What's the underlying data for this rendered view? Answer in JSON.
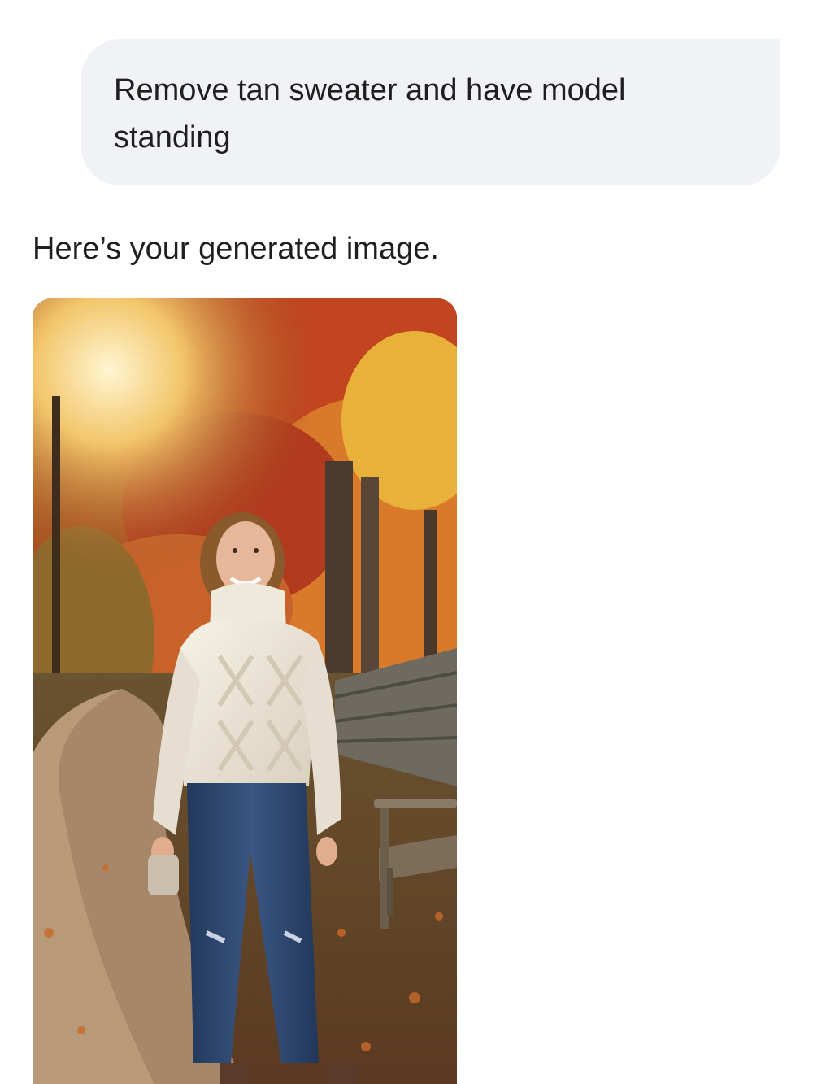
{
  "conversation": {
    "user_message": "Remove tan sweater and have model standing",
    "assistant_reply": "Here’s your generated image."
  },
  "generated_image": {
    "alt": "",
    "colors": {
      "foliage_orange": "#d9792a",
      "foliage_red": "#b23a1f",
      "foliage_yellow": "#e8b13a",
      "sunlight": "#fff3c8",
      "path": "#b89a78",
      "sweater": "#efe9dc",
      "jeans": "#2f4a72",
      "stone_wall": "#6e6a60",
      "bench": "#8a7a66"
    }
  }
}
